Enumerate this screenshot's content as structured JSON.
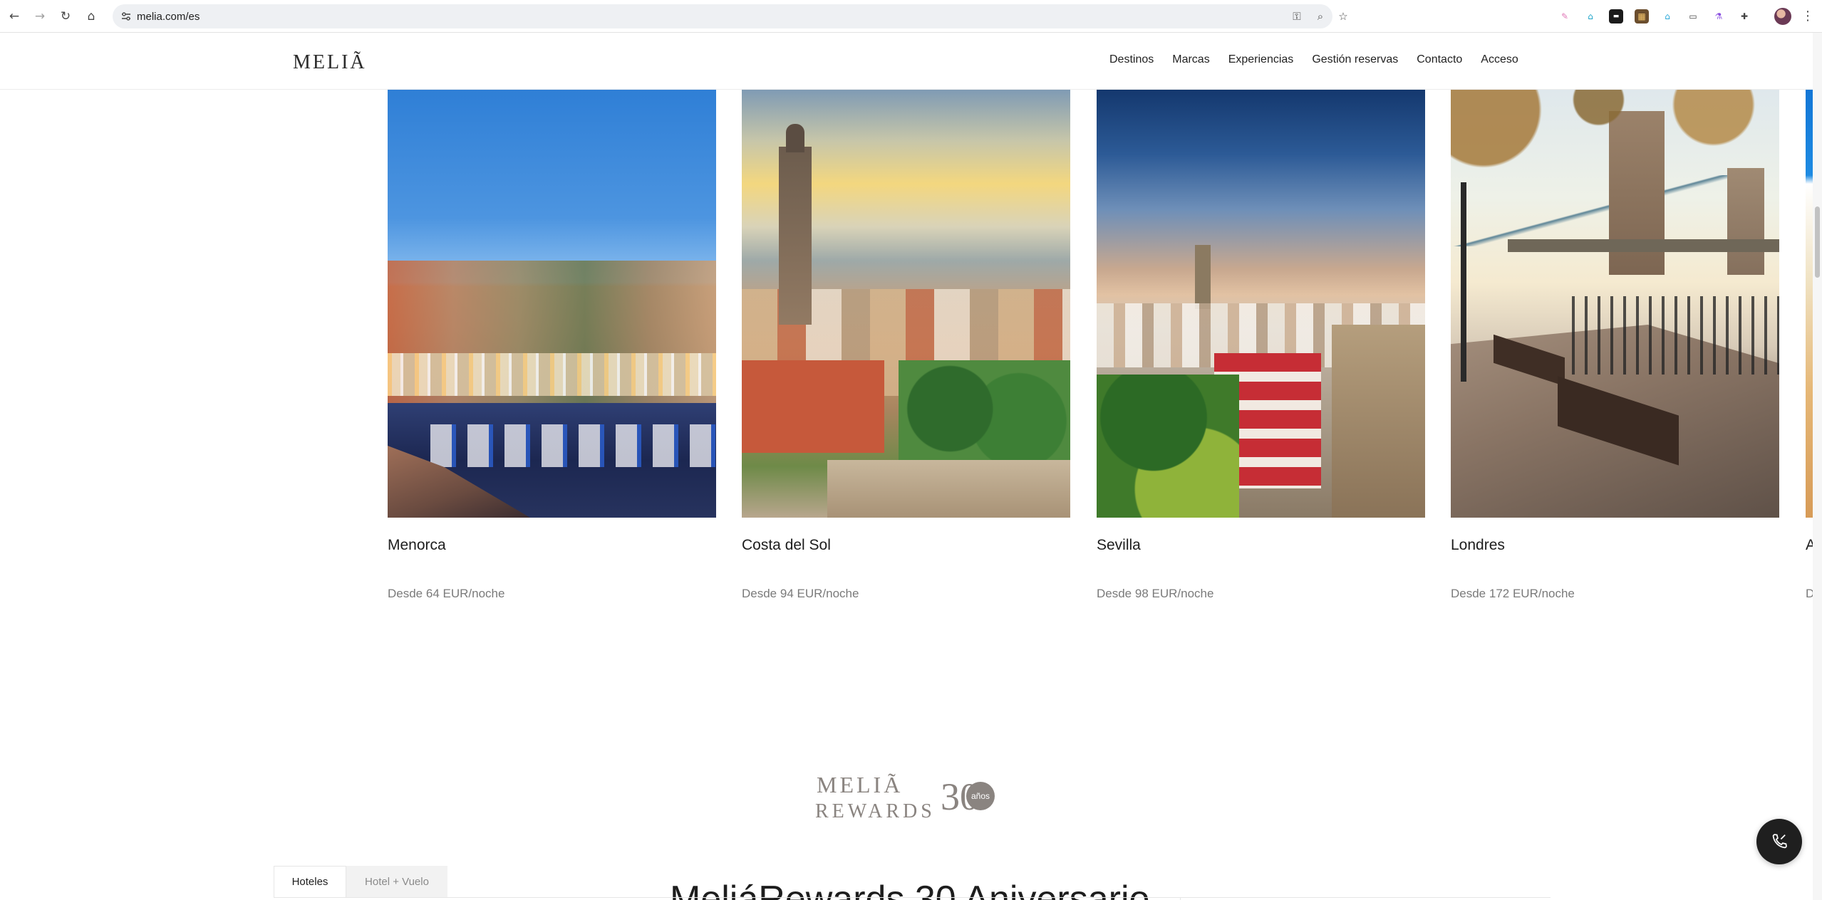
{
  "browser": {
    "url": "melia.com/es"
  },
  "header": {
    "logo": "MELIÃ",
    "nav": [
      "Destinos",
      "Marcas",
      "Experiencias",
      "Gestión reservas",
      "Contacto",
      "Acceso"
    ]
  },
  "destinations": [
    {
      "name": "Menorca",
      "price": "Desde 64 EUR/noche"
    },
    {
      "name": "Costa del Sol",
      "price": "Desde 94 EUR/noche"
    },
    {
      "name": "Sevilla",
      "price": "Desde 98 EUR/noche"
    },
    {
      "name": "Londres",
      "price": "Desde 172 EUR/noche"
    }
  ],
  "partial_destination": {
    "name": "A",
    "price": "D"
  },
  "rewards": {
    "brand": "MELIÃ",
    "program": "REWARDS",
    "anniversary_number": "30",
    "anniversary_suffix": "años",
    "heading": "MeliáRewards 30 Aniversario"
  },
  "search_tabs": [
    "Hoteles",
    "Hotel + Vuelo"
  ],
  "colors": {
    "accent": "#1d1d1d",
    "muted_text": "#7a7a7a",
    "rewards_grey": "#8a8480"
  }
}
